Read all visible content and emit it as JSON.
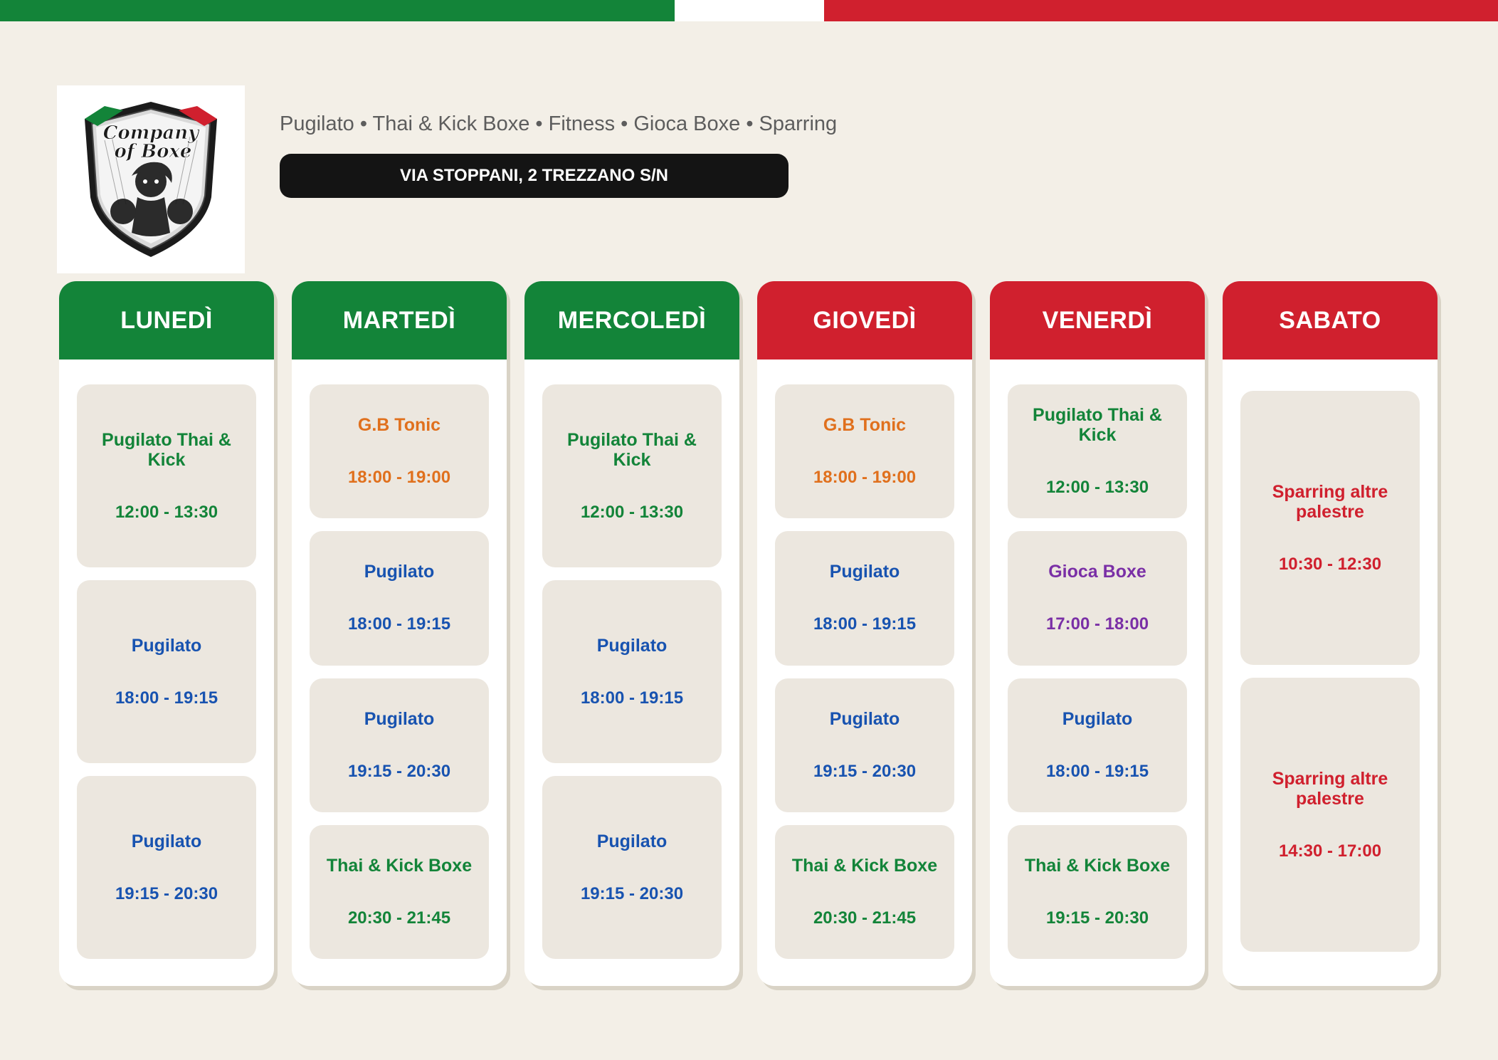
{
  "header": {
    "logo": {
      "line1": "Company",
      "line2": "of Boxe"
    },
    "tagline": "Pugilato • Thai & Kick Boxe • Fitness • Gioca Boxe • Sparring",
    "address": "VIA STOPPANI, 2 TREZZANO S/N"
  },
  "colors": {
    "green": "#138439",
    "red": "#d0202e",
    "blue": "#1853b0",
    "orange": "#e0701d",
    "purple": "#7a2fa6",
    "background": "#f3efe7",
    "slot": "#ece7df"
  },
  "days": [
    {
      "name": "LUNEDÌ",
      "color": "green",
      "slots": [
        {
          "title": "Pugilato Thai & Kick",
          "time": "12:00 - 13:30",
          "color": "green"
        },
        {
          "title": "Pugilato",
          "time": "18:00 - 19:15",
          "color": "blue"
        },
        {
          "title": "Pugilato",
          "time": "19:15 - 20:30",
          "color": "blue"
        }
      ]
    },
    {
      "name": "MARTEDÌ",
      "color": "green",
      "slots": [
        {
          "title": "G.B Tonic",
          "time": "18:00 - 19:00",
          "color": "orange"
        },
        {
          "title": "Pugilato",
          "time": "18:00 - 19:15",
          "color": "blue"
        },
        {
          "title": "Pugilato",
          "time": "19:15 - 20:30",
          "color": "blue"
        },
        {
          "title": "Thai & Kick Boxe",
          "time": "20:30 - 21:45",
          "color": "green"
        }
      ]
    },
    {
      "name": "MERCOLEDÌ",
      "color": "green",
      "slots": [
        {
          "title": "Pugilato Thai & Kick",
          "time": "12:00 - 13:30",
          "color": "green"
        },
        {
          "title": "Pugilato",
          "time": "18:00 - 19:15",
          "color": "blue"
        },
        {
          "title": "Pugilato",
          "time": "19:15 - 20:30",
          "color": "blue"
        }
      ]
    },
    {
      "name": "GIOVEDÌ",
      "color": "red",
      "slots": [
        {
          "title": "G.B Tonic",
          "time": "18:00 - 19:00",
          "color": "orange"
        },
        {
          "title": "Pugilato",
          "time": "18:00 - 19:15",
          "color": "blue"
        },
        {
          "title": "Pugilato",
          "time": "19:15 - 20:30",
          "color": "blue"
        },
        {
          "title": "Thai & Kick Boxe",
          "time": "20:30 - 21:45",
          "color": "green"
        }
      ]
    },
    {
      "name": "VENERDÌ",
      "color": "red",
      "slots": [
        {
          "title": "Pugilato Thai & Kick",
          "time": "12:00 - 13:30",
          "color": "green"
        },
        {
          "title": "Gioca Boxe",
          "time": "17:00 - 18:00",
          "color": "purple"
        },
        {
          "title": "Pugilato",
          "time": "18:00 - 19:15",
          "color": "blue"
        },
        {
          "title": "Thai & Kick Boxe",
          "time": "19:15 - 20:30",
          "color": "green"
        }
      ]
    },
    {
      "name": "SABATO",
      "color": "red",
      "slots": [
        {
          "title": "Sparring altre palestre",
          "time": "10:30 - 12:30",
          "color": "red"
        },
        {
          "title": "Sparring altre palestre",
          "time": "14:30 - 17:00",
          "color": "red"
        }
      ]
    }
  ]
}
